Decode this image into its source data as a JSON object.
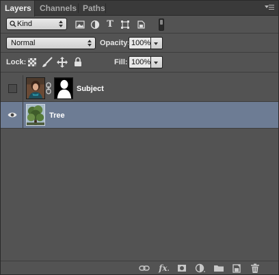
{
  "tabs": [
    {
      "label": "Layers",
      "active": true
    },
    {
      "label": "Channels",
      "active": false
    },
    {
      "label": "Paths",
      "active": false
    }
  ],
  "filter": {
    "kind_label": "Kind",
    "icons": [
      "pixel-filter-icon",
      "adjustment-filter-icon",
      "type-filter-icon",
      "shape-filter-icon",
      "smart-object-filter-icon"
    ],
    "type_glyph": "T"
  },
  "blend": {
    "mode": "Normal",
    "opacity_label": "Opacity:",
    "opacity_value": "100%"
  },
  "lock": {
    "label": "Lock:",
    "fill_label": "Fill:",
    "fill_value": "100%"
  },
  "layers": [
    {
      "name": "Subject",
      "visible": false,
      "selected": false,
      "has_mask": true
    },
    {
      "name": "Tree",
      "visible": true,
      "selected": true,
      "has_mask": false
    }
  ],
  "bottom_icons": [
    "link-layers-icon",
    "fx-icon",
    "add-mask-icon",
    "adjustment-layer-icon",
    "new-group-icon",
    "new-layer-icon",
    "delete-layer-icon"
  ],
  "fx_label": "fx",
  "colors": {
    "panel": "#535353",
    "selected_row": "#6d7c94",
    "tabbar": "#3a3a3a"
  }
}
